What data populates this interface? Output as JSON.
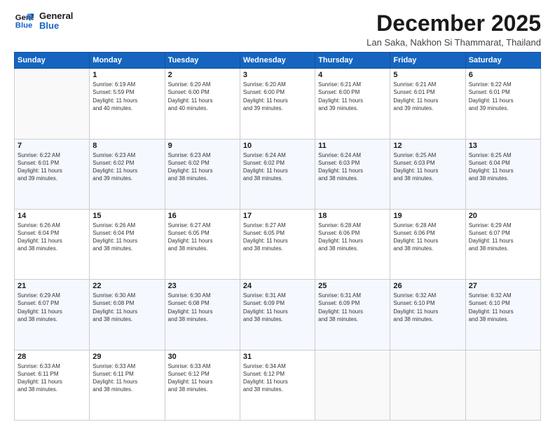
{
  "logo": {
    "line1": "General",
    "line2": "Blue"
  },
  "title": "December 2025",
  "location": "Lan Saka, Nakhon Si Thammarat, Thailand",
  "days_of_week": [
    "Sunday",
    "Monday",
    "Tuesday",
    "Wednesday",
    "Thursday",
    "Friday",
    "Saturday"
  ],
  "weeks": [
    [
      {
        "day": "",
        "info": ""
      },
      {
        "day": "1",
        "info": "Sunrise: 6:19 AM\nSunset: 5:59 PM\nDaylight: 11 hours\nand 40 minutes."
      },
      {
        "day": "2",
        "info": "Sunrise: 6:20 AM\nSunset: 6:00 PM\nDaylight: 11 hours\nand 40 minutes."
      },
      {
        "day": "3",
        "info": "Sunrise: 6:20 AM\nSunset: 6:00 PM\nDaylight: 11 hours\nand 39 minutes."
      },
      {
        "day": "4",
        "info": "Sunrise: 6:21 AM\nSunset: 6:00 PM\nDaylight: 11 hours\nand 39 minutes."
      },
      {
        "day": "5",
        "info": "Sunrise: 6:21 AM\nSunset: 6:01 PM\nDaylight: 11 hours\nand 39 minutes."
      },
      {
        "day": "6",
        "info": "Sunrise: 6:22 AM\nSunset: 6:01 PM\nDaylight: 11 hours\nand 39 minutes."
      }
    ],
    [
      {
        "day": "7",
        "info": "Sunrise: 6:22 AM\nSunset: 6:01 PM\nDaylight: 11 hours\nand 39 minutes."
      },
      {
        "day": "8",
        "info": "Sunrise: 6:23 AM\nSunset: 6:02 PM\nDaylight: 11 hours\nand 39 minutes."
      },
      {
        "day": "9",
        "info": "Sunrise: 6:23 AM\nSunset: 6:02 PM\nDaylight: 11 hours\nand 38 minutes."
      },
      {
        "day": "10",
        "info": "Sunrise: 6:24 AM\nSunset: 6:02 PM\nDaylight: 11 hours\nand 38 minutes."
      },
      {
        "day": "11",
        "info": "Sunrise: 6:24 AM\nSunset: 6:03 PM\nDaylight: 11 hours\nand 38 minutes."
      },
      {
        "day": "12",
        "info": "Sunrise: 6:25 AM\nSunset: 6:03 PM\nDaylight: 11 hours\nand 38 minutes."
      },
      {
        "day": "13",
        "info": "Sunrise: 6:25 AM\nSunset: 6:04 PM\nDaylight: 11 hours\nand 38 minutes."
      }
    ],
    [
      {
        "day": "14",
        "info": "Sunrise: 6:26 AM\nSunset: 6:04 PM\nDaylight: 11 hours\nand 38 minutes."
      },
      {
        "day": "15",
        "info": "Sunrise: 6:26 AM\nSunset: 6:04 PM\nDaylight: 11 hours\nand 38 minutes."
      },
      {
        "day": "16",
        "info": "Sunrise: 6:27 AM\nSunset: 6:05 PM\nDaylight: 11 hours\nand 38 minutes."
      },
      {
        "day": "17",
        "info": "Sunrise: 6:27 AM\nSunset: 6:05 PM\nDaylight: 11 hours\nand 38 minutes."
      },
      {
        "day": "18",
        "info": "Sunrise: 6:28 AM\nSunset: 6:06 PM\nDaylight: 11 hours\nand 38 minutes."
      },
      {
        "day": "19",
        "info": "Sunrise: 6:28 AM\nSunset: 6:06 PM\nDaylight: 11 hours\nand 38 minutes."
      },
      {
        "day": "20",
        "info": "Sunrise: 6:29 AM\nSunset: 6:07 PM\nDaylight: 11 hours\nand 38 minutes."
      }
    ],
    [
      {
        "day": "21",
        "info": "Sunrise: 6:29 AM\nSunset: 6:07 PM\nDaylight: 11 hours\nand 38 minutes."
      },
      {
        "day": "22",
        "info": "Sunrise: 6:30 AM\nSunset: 6:08 PM\nDaylight: 11 hours\nand 38 minutes."
      },
      {
        "day": "23",
        "info": "Sunrise: 6:30 AM\nSunset: 6:08 PM\nDaylight: 11 hours\nand 38 minutes."
      },
      {
        "day": "24",
        "info": "Sunrise: 6:31 AM\nSunset: 6:09 PM\nDaylight: 11 hours\nand 38 minutes."
      },
      {
        "day": "25",
        "info": "Sunrise: 6:31 AM\nSunset: 6:09 PM\nDaylight: 11 hours\nand 38 minutes."
      },
      {
        "day": "26",
        "info": "Sunrise: 6:32 AM\nSunset: 6:10 PM\nDaylight: 11 hours\nand 38 minutes."
      },
      {
        "day": "27",
        "info": "Sunrise: 6:32 AM\nSunset: 6:10 PM\nDaylight: 11 hours\nand 38 minutes."
      }
    ],
    [
      {
        "day": "28",
        "info": "Sunrise: 6:33 AM\nSunset: 6:11 PM\nDaylight: 11 hours\nand 38 minutes."
      },
      {
        "day": "29",
        "info": "Sunrise: 6:33 AM\nSunset: 6:11 PM\nDaylight: 11 hours\nand 38 minutes."
      },
      {
        "day": "30",
        "info": "Sunrise: 6:33 AM\nSunset: 6:12 PM\nDaylight: 11 hours\nand 38 minutes."
      },
      {
        "day": "31",
        "info": "Sunrise: 6:34 AM\nSunset: 6:12 PM\nDaylight: 11 hours\nand 38 minutes."
      },
      {
        "day": "",
        "info": ""
      },
      {
        "day": "",
        "info": ""
      },
      {
        "day": "",
        "info": ""
      }
    ]
  ]
}
